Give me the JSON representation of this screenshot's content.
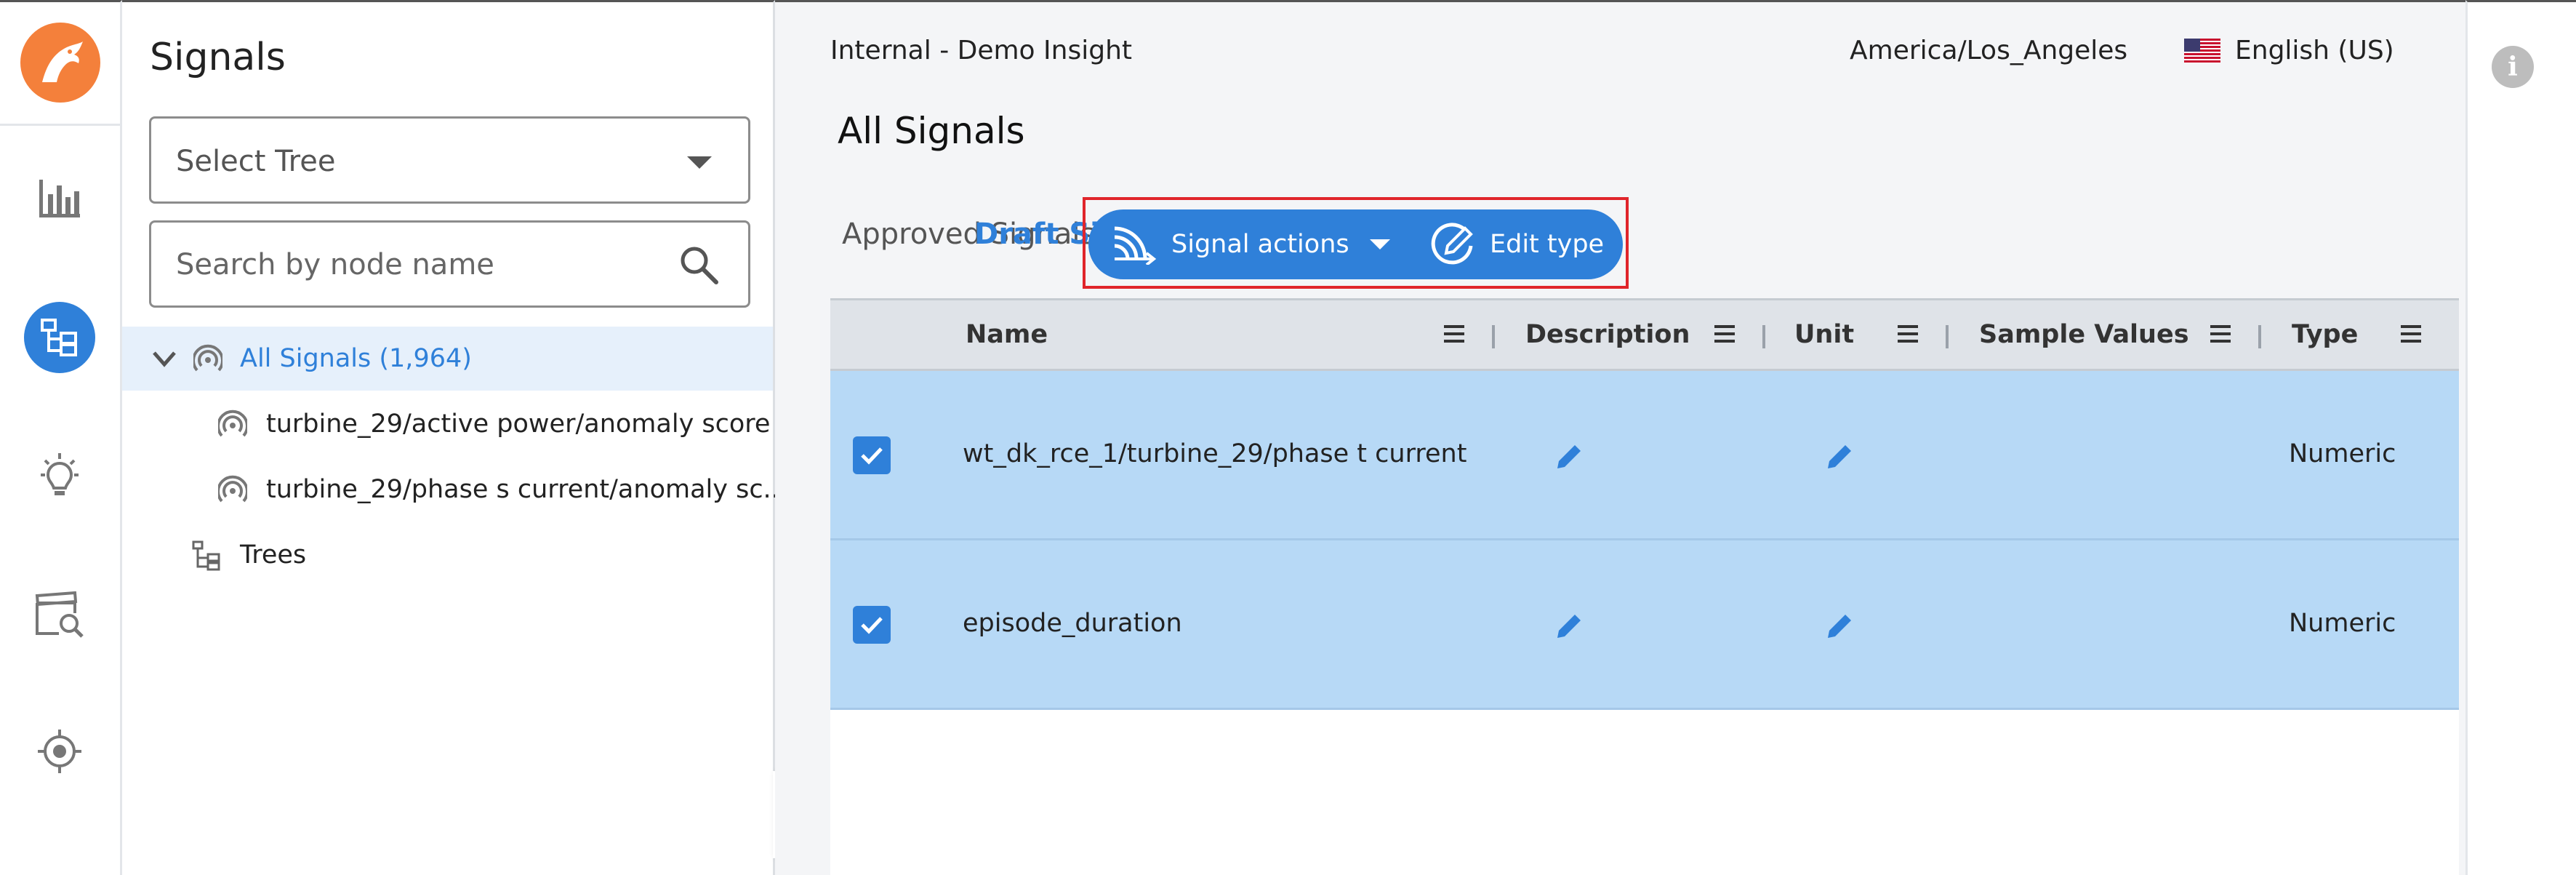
{
  "app": {
    "brand_color": "#f4803b",
    "accent_color": "#2f80d9"
  },
  "rail": {
    "items": [
      {
        "name": "analytics",
        "icon": "bar-chart-icon"
      },
      {
        "name": "signals",
        "icon": "signal-tree-icon",
        "active": true
      },
      {
        "name": "insights",
        "icon": "lightbulb-icon"
      },
      {
        "name": "episodes",
        "icon": "clapper-search-icon"
      },
      {
        "name": "targets",
        "icon": "target-icon"
      }
    ]
  },
  "tree": {
    "title": "Signals",
    "select_placeholder": "Select Tree",
    "search_placeholder": "Search by node name",
    "root_label": "All Signals (1,964)",
    "children": [
      "turbine_29/active power/anomaly score",
      "turbine_29/phase s current/anomaly sc..."
    ],
    "trees_label": "Trees"
  },
  "header": {
    "org": "Internal - Demo Insight",
    "timezone": "America/Los_Angeles",
    "language": "English (US)"
  },
  "page": {
    "title": "All Signals",
    "tabs": {
      "approved": "Approved Signals",
      "draft": "Draft Signals"
    },
    "actions": {
      "signal_actions": "Signal actions",
      "edit_type": "Edit type"
    }
  },
  "table": {
    "columns": {
      "name": "Name",
      "description": "Description",
      "unit": "Unit",
      "sample_values": "Sample Values",
      "type": "Type"
    },
    "rows": [
      {
        "name": "wt_dk_rce_1/turbine_29/phase t current",
        "type": "Numeric",
        "selected": true
      },
      {
        "name": "episode_duration",
        "type": "Numeric",
        "selected": true
      }
    ]
  }
}
